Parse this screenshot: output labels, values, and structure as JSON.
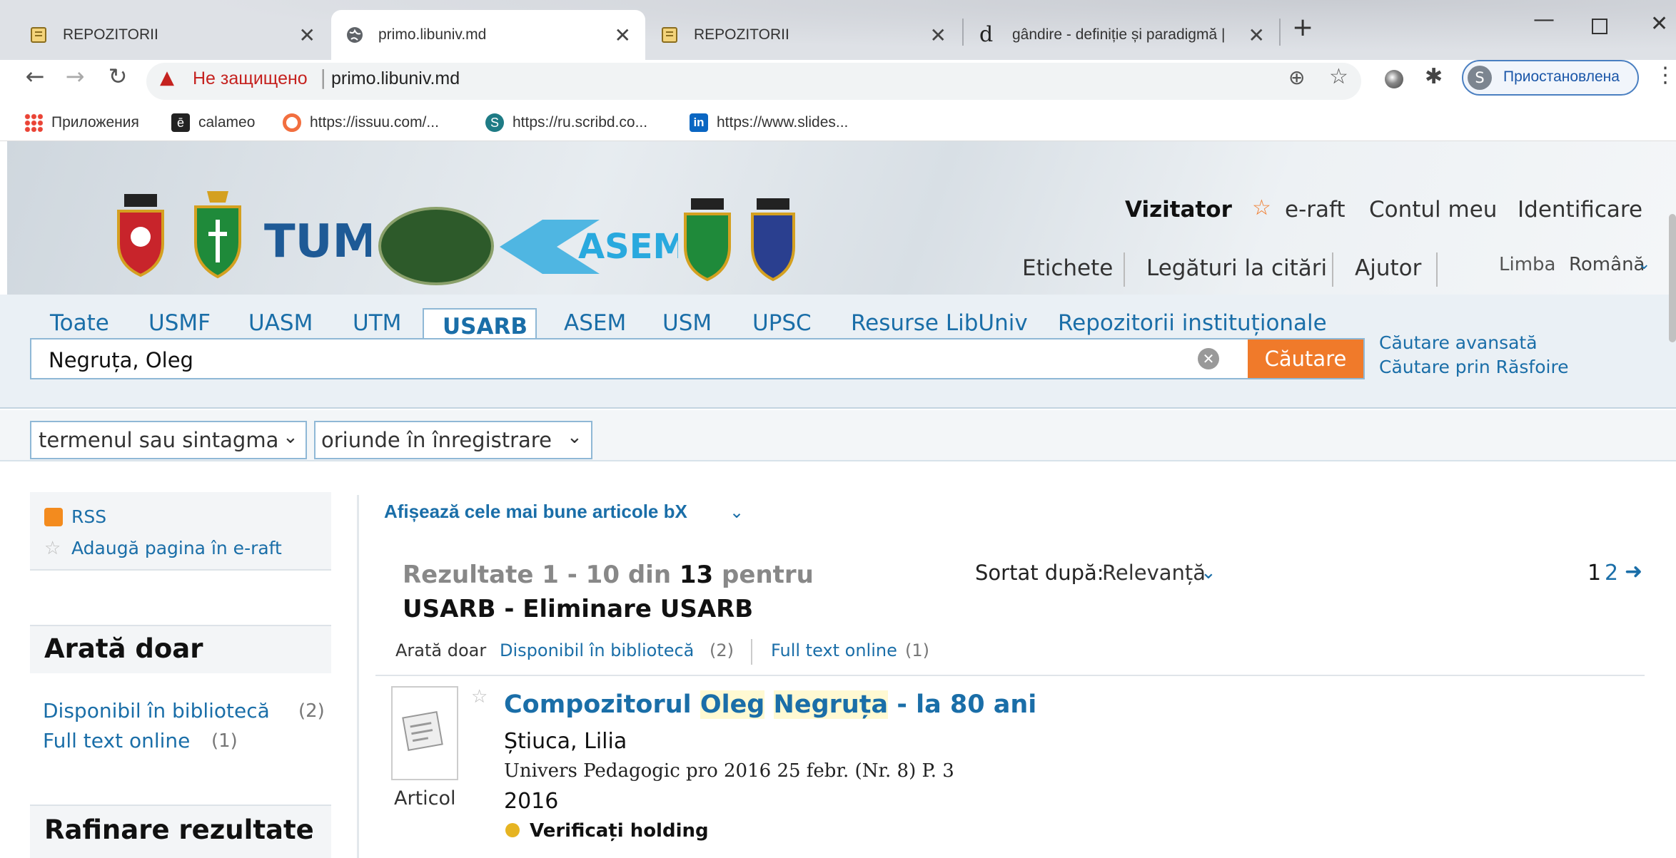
{
  "browser": {
    "tabs": [
      {
        "title": "REPOZITORII",
        "icon": "note-icon",
        "active": false
      },
      {
        "title": "primo.libuniv.md",
        "icon": "globe-icon",
        "active": true
      },
      {
        "title": "REPOZITORII",
        "icon": "note-icon",
        "active": false
      },
      {
        "title": "gândire - definiție și paradigmă |",
        "icon": "dexonline-icon",
        "active": false
      }
    ],
    "new_tab": "+",
    "security_label": "Не защищено",
    "url": "primo.libuniv.md",
    "profile_initial": "S",
    "profile_label": "Приостановлена",
    "bookmarks": [
      {
        "label": "Приложения",
        "icon": "apps-grid-icon"
      },
      {
        "label": "calameo",
        "icon": "calameo-icon"
      },
      {
        "label": "https://issuu.com/...",
        "icon": "issuu-icon"
      },
      {
        "label": "https://ru.scribd.co...",
        "icon": "scribd-icon"
      },
      {
        "label": "https://www.slides...",
        "icon": "linkedin-icon"
      }
    ]
  },
  "site": {
    "user_links": {
      "visitor": "Vizitator",
      "eshelf": "e-raft",
      "account": "Contul meu",
      "login": "Identificare"
    },
    "sub_links": {
      "tags": "Etichete",
      "citation_links": "Legături la citări",
      "help": "Ajutor"
    },
    "language_label": "Limba",
    "language_value": "Română",
    "scope_tabs": [
      "Toate",
      "USMF",
      "UASM",
      "UTM",
      "USARB",
      "ASEM",
      "USM",
      "UPSC",
      "Resurse LibUniv",
      "Repozitorii instituționale"
    ],
    "active_scope": "USARB",
    "search_value": "Negruța, Oleg",
    "search_button": "Căutare",
    "advanced_search": "Căutare avansată",
    "browse_search": "Căutare prin Răsfoire",
    "filter_term": "termenul sau sintagma",
    "filter_field": "oriunde în înregistrare"
  },
  "sidebar": {
    "rss": "RSS",
    "add_page": "Adaugă pagina în e-raft",
    "show_only_title": "Arată doar",
    "facets": [
      {
        "label": "Disponibil în bibliotecă",
        "count": "(2)"
      },
      {
        "label": "Full text online",
        "count": "(1)"
      }
    ],
    "refine_title": "Rafinare rezultate"
  },
  "results": {
    "bx_link": "Afișează cele mai bune articole bX",
    "summary_prefix": "Rezultate 1 - 10 din",
    "total": "13",
    "summary_suffix": "pentru",
    "scope_line": "USARB - Eliminare USARB",
    "sort_label": "Sortat după:",
    "sort_value": "Relevanță",
    "pages": {
      "current": "1",
      "next": "2"
    },
    "show_only_label": "Arată doar",
    "facet_inline": [
      {
        "label": "Disponibil în bibliotecă",
        "count": "(2)"
      },
      {
        "label": "Full text online",
        "count": "(1)"
      }
    ],
    "items": [
      {
        "title_prefix": "Compozitorul ",
        "title_hl1": "Oleg",
        "title_space": " ",
        "title_hl2": "Negruța",
        "title_suffix": " - la 80 ani",
        "author": "Știuca, Lilia",
        "source": "Univers Pedagogic pro 2016 25 febr. (Nr. 8) P. 3",
        "year": "2016",
        "type": "Articol",
        "availability": "Verificați holding"
      }
    ]
  },
  "colors": {
    "accent_blue": "#1a6ea8",
    "search_orange": "#f07a2a",
    "security_red": "#c5221f"
  }
}
